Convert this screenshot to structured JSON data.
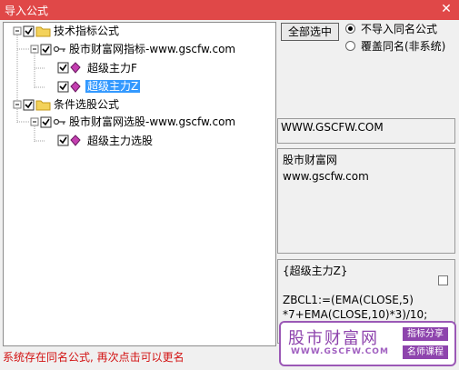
{
  "window": {
    "title": "导入公式",
    "close_glyph": "✕"
  },
  "tree": {
    "root1": "技术指标公式",
    "child1": "股市财富网指标-www.gscfw.com",
    "leaf1": "超级主力F",
    "leaf2": "超级主力Z",
    "root2": "条件选股公式",
    "child2": "股市财富网选股-www.gscfw.com",
    "leaf3": "超级主力选股"
  },
  "controls": {
    "select_all": "全部选中",
    "opt_skip": "不导入同名公式",
    "opt_overwrite": "覆盖同名(非系统)",
    "selected_option": "opt_skip"
  },
  "info": {
    "website": "WWW.GSCFW.COM",
    "author_line1": "股市财富网",
    "author_line2": "www.gscfw.com",
    "formula_title": "{超级主力Z}",
    "formula_line1": "ZBCL1:=(EMA(CLOSE,5)",
    "formula_line2": "*7+EMA(CLOSE,10)*3)/10;"
  },
  "status": "系统存在同名公式, 再次点击可以更名",
  "watermark": {
    "name": "股市财富网",
    "url": "WWW.GSCFW.COM",
    "tag1": "指标分享",
    "tag2": "名师课程"
  }
}
